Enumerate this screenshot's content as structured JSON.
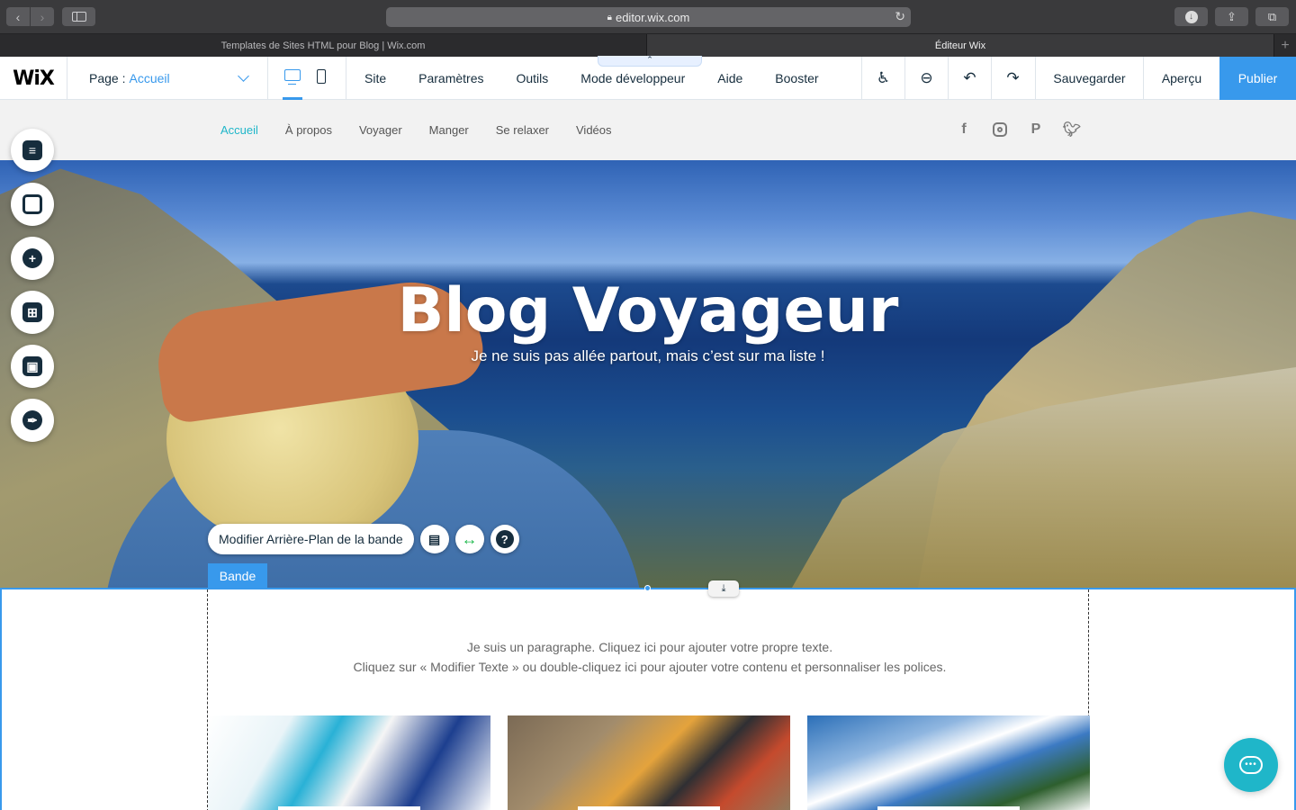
{
  "browser": {
    "url": "editor.wix.com",
    "tabs": [
      {
        "title": "Templates de Sites HTML pour Blog | Wix.com"
      },
      {
        "title": "Éditeur Wix"
      }
    ]
  },
  "editor": {
    "logo": "WiX",
    "page_prefix": "Page :",
    "page_name": "Accueil",
    "menu": [
      "Site",
      "Paramètres",
      "Outils",
      "Mode développeur",
      "Aide",
      "Booster"
    ],
    "save_label": "Sauvegarder",
    "preview_label": "Aperçu",
    "publish_label": "Publier",
    "accent_color": "#3899ec"
  },
  "site": {
    "nav": [
      {
        "label": "Accueil",
        "active": true
      },
      {
        "label": "À propos"
      },
      {
        "label": "Voyager"
      },
      {
        "label": "Manger"
      },
      {
        "label": "Se relaxer"
      },
      {
        "label": "Vidéos"
      }
    ],
    "social_icons": [
      "facebook-icon",
      "instagram-icon",
      "pinterest-icon",
      "twitter-icon"
    ],
    "hero": {
      "title": "Blog Voyageur",
      "subtitle": "Je ne suis pas allée partout, mais c’est sur ma liste !"
    },
    "strip": {
      "change_bg_label": "Modifier Arrière-Plan de la bande",
      "label": "Bande"
    },
    "paragraph": {
      "line1": "Je suis un paragraphe. Cliquez ici pour ajouter votre propre texte.",
      "line2": "Cliquez sur « Modifier Texte » ou double-cliquez ici pour ajouter votre contenu et personnaliser les polices."
    },
    "accent_color": "#1fb6c9"
  }
}
